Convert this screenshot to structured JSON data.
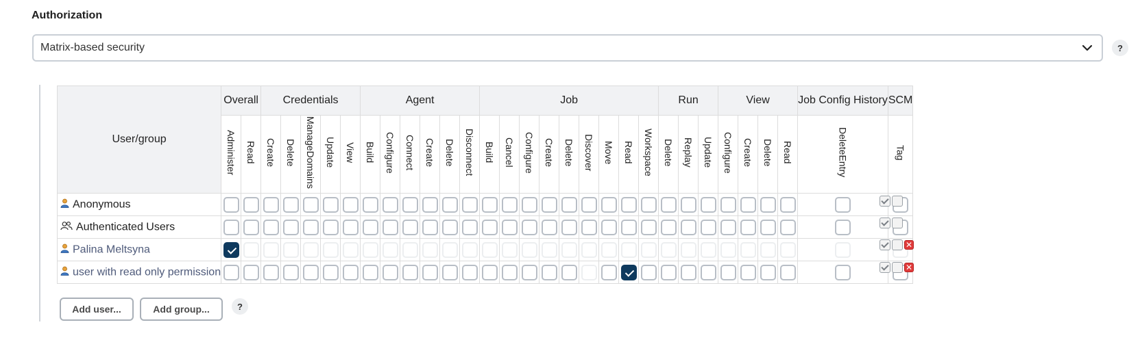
{
  "section": {
    "title": "Authorization"
  },
  "strategy": {
    "selected": "Matrix-based security",
    "help": "?"
  },
  "matrix": {
    "user_group_header": "User/group",
    "groups": [
      {
        "label": "Overall",
        "perms": [
          "Administer",
          "Read"
        ]
      },
      {
        "label": "Credentials",
        "perms": [
          "Create",
          "Delete",
          "ManageDomains",
          "Update",
          "View"
        ]
      },
      {
        "label": "Agent",
        "perms": [
          "Build",
          "Configure",
          "Connect",
          "Create",
          "Delete",
          "Disconnect"
        ]
      },
      {
        "label": "Job",
        "perms": [
          "Build",
          "Cancel",
          "Configure",
          "Create",
          "Delete",
          "Discover",
          "Move",
          "Read",
          "Workspace"
        ]
      },
      {
        "label": "Run",
        "perms": [
          "Delete",
          "Replay",
          "Update"
        ]
      },
      {
        "label": "View",
        "perms": [
          "Configure",
          "Create",
          "Delete",
          "Read"
        ]
      },
      {
        "label": "Job Config History",
        "perms": [
          "DeleteEntry"
        ]
      },
      {
        "label": "SCM",
        "perms": [
          "Tag"
        ]
      }
    ],
    "rows": [
      {
        "name": "Anonymous",
        "type": "user",
        "linked": false,
        "checked": [],
        "faint_all": false,
        "faint": [],
        "deletable": false
      },
      {
        "name": "Authenticated Users",
        "type": "group",
        "linked": false,
        "checked": [],
        "faint_all": false,
        "faint": [],
        "deletable": false
      },
      {
        "name": "Palina Meltsyna",
        "type": "user",
        "linked": true,
        "checked": [
          0
        ],
        "faint_all": true,
        "faint": [],
        "deletable": true
      },
      {
        "name": "user with read only permission",
        "type": "user",
        "linked": true,
        "checked": [
          20
        ],
        "faint_all": false,
        "faint": [
          18
        ],
        "deletable": true
      }
    ]
  },
  "buttons": {
    "add_user": "Add user...",
    "add_group": "Add group...",
    "help": "?"
  },
  "icons": {
    "dropdown": "chevron-down-icon",
    "user": "user-icon",
    "group": "group-icon",
    "select_all": "check-all-icon",
    "unselect_all": "uncheck-all-icon",
    "remove": "remove-icon"
  },
  "colors": {
    "checked": "#0f3a5e",
    "remove": "#e03b3b"
  }
}
